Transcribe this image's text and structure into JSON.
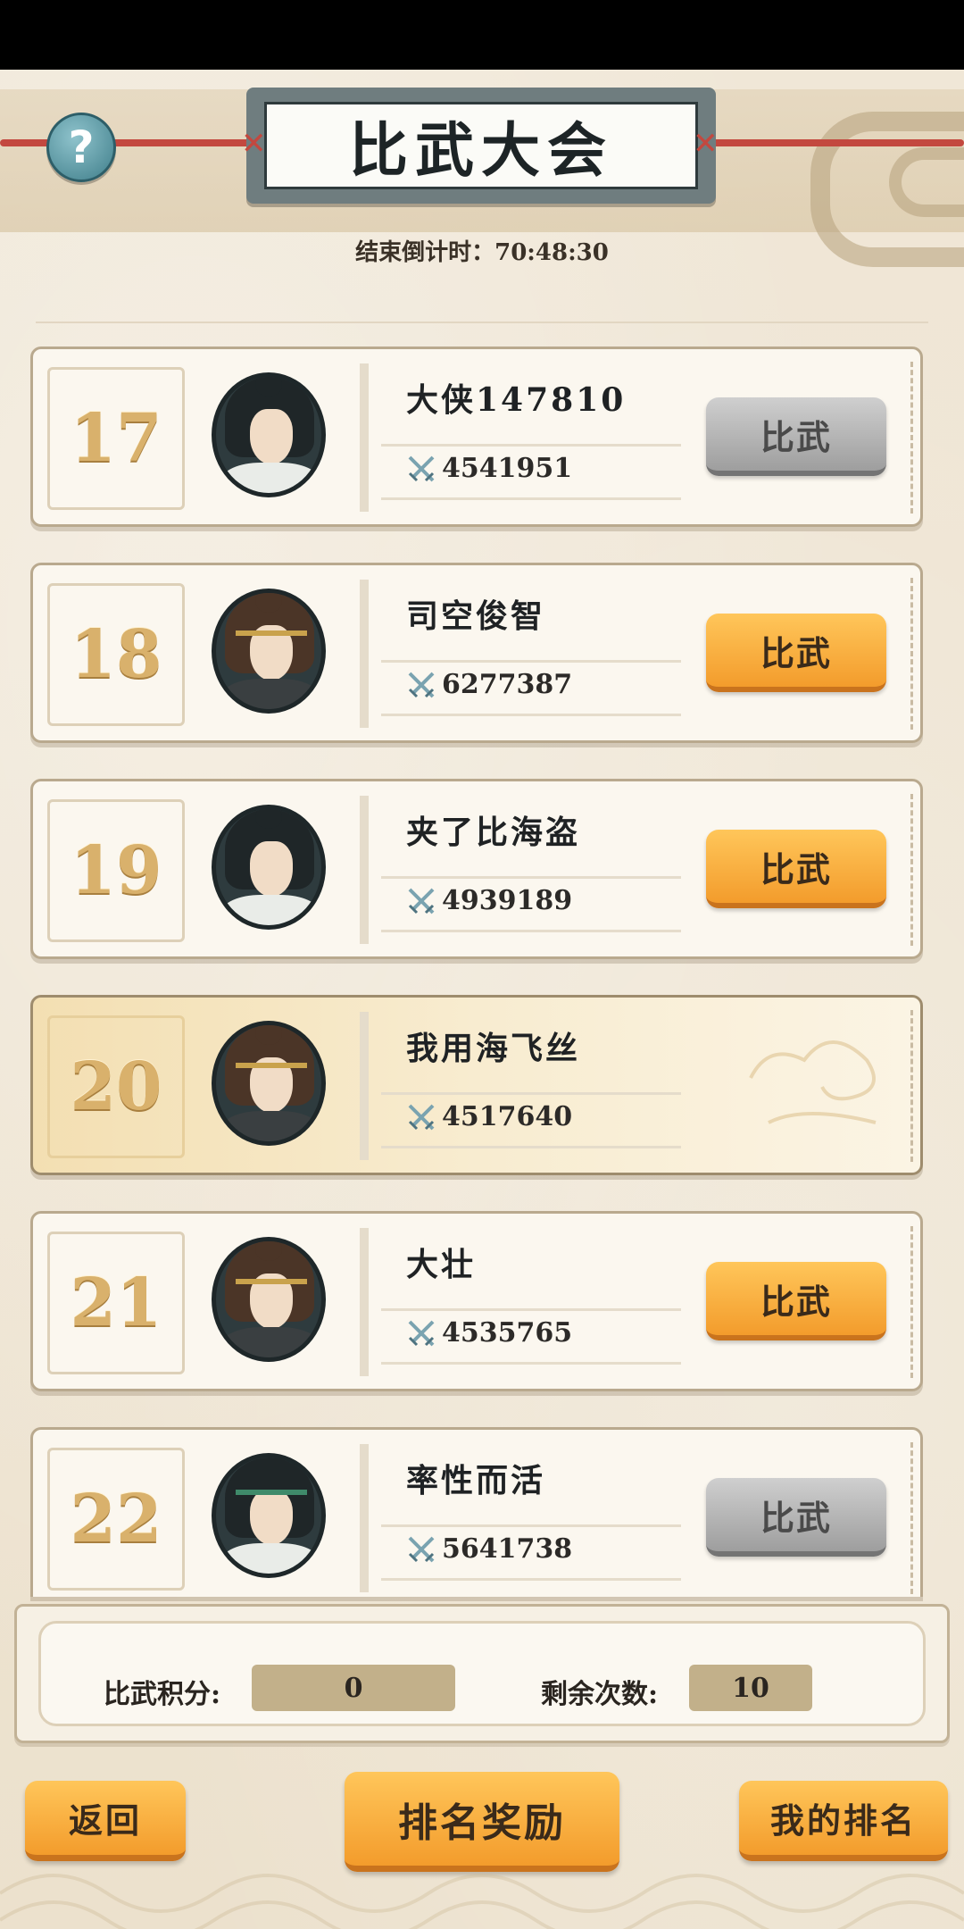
{
  "header": {
    "title": "比武大会",
    "countdown": "结束倒计时：70:48:30"
  },
  "rankings": [
    {
      "rank": "17",
      "name": "大侠147810",
      "power": "4541951",
      "button": "比武",
      "button_state": "disabled",
      "avatar": "black-hair-white-robe",
      "is_self": false
    },
    {
      "rank": "18",
      "name": "司空俊智",
      "power": "6277387",
      "button": "比武",
      "button_state": "active",
      "avatar": "brown-hair-headband",
      "is_self": false
    },
    {
      "rank": "19",
      "name": "夹了比海盗",
      "power": "4939189",
      "button": "比武",
      "button_state": "active",
      "avatar": "black-hair-white-robe",
      "is_self": false
    },
    {
      "rank": "20",
      "name": "我用海飞丝",
      "power": "4517640",
      "button": "",
      "button_state": "none",
      "avatar": "brown-hair-headband",
      "is_self": true
    },
    {
      "rank": "21",
      "name": "大壮",
      "power": "4535765",
      "button": "比武",
      "button_state": "active",
      "avatar": "brown-hair-headband",
      "is_self": false
    },
    {
      "rank": "22",
      "name": "率性而活",
      "power": "5641738",
      "button": "比武",
      "button_state": "disabled",
      "avatar": "spiky-hair-green-band",
      "is_self": false
    }
  ],
  "summary": {
    "points_label": "比武积分:",
    "points_value": "0",
    "remaining_label": "剩余次数:",
    "remaining_value": "10"
  },
  "footer": {
    "back": "返回",
    "rank_rewards": "排名奖励",
    "my_rank": "我的排名"
  },
  "colors": {
    "accent_orange": "#f7a93a",
    "disabled_gray": "#b0b0b0",
    "rope_red": "#c3483f",
    "rank_gold": "#d9b16c"
  }
}
